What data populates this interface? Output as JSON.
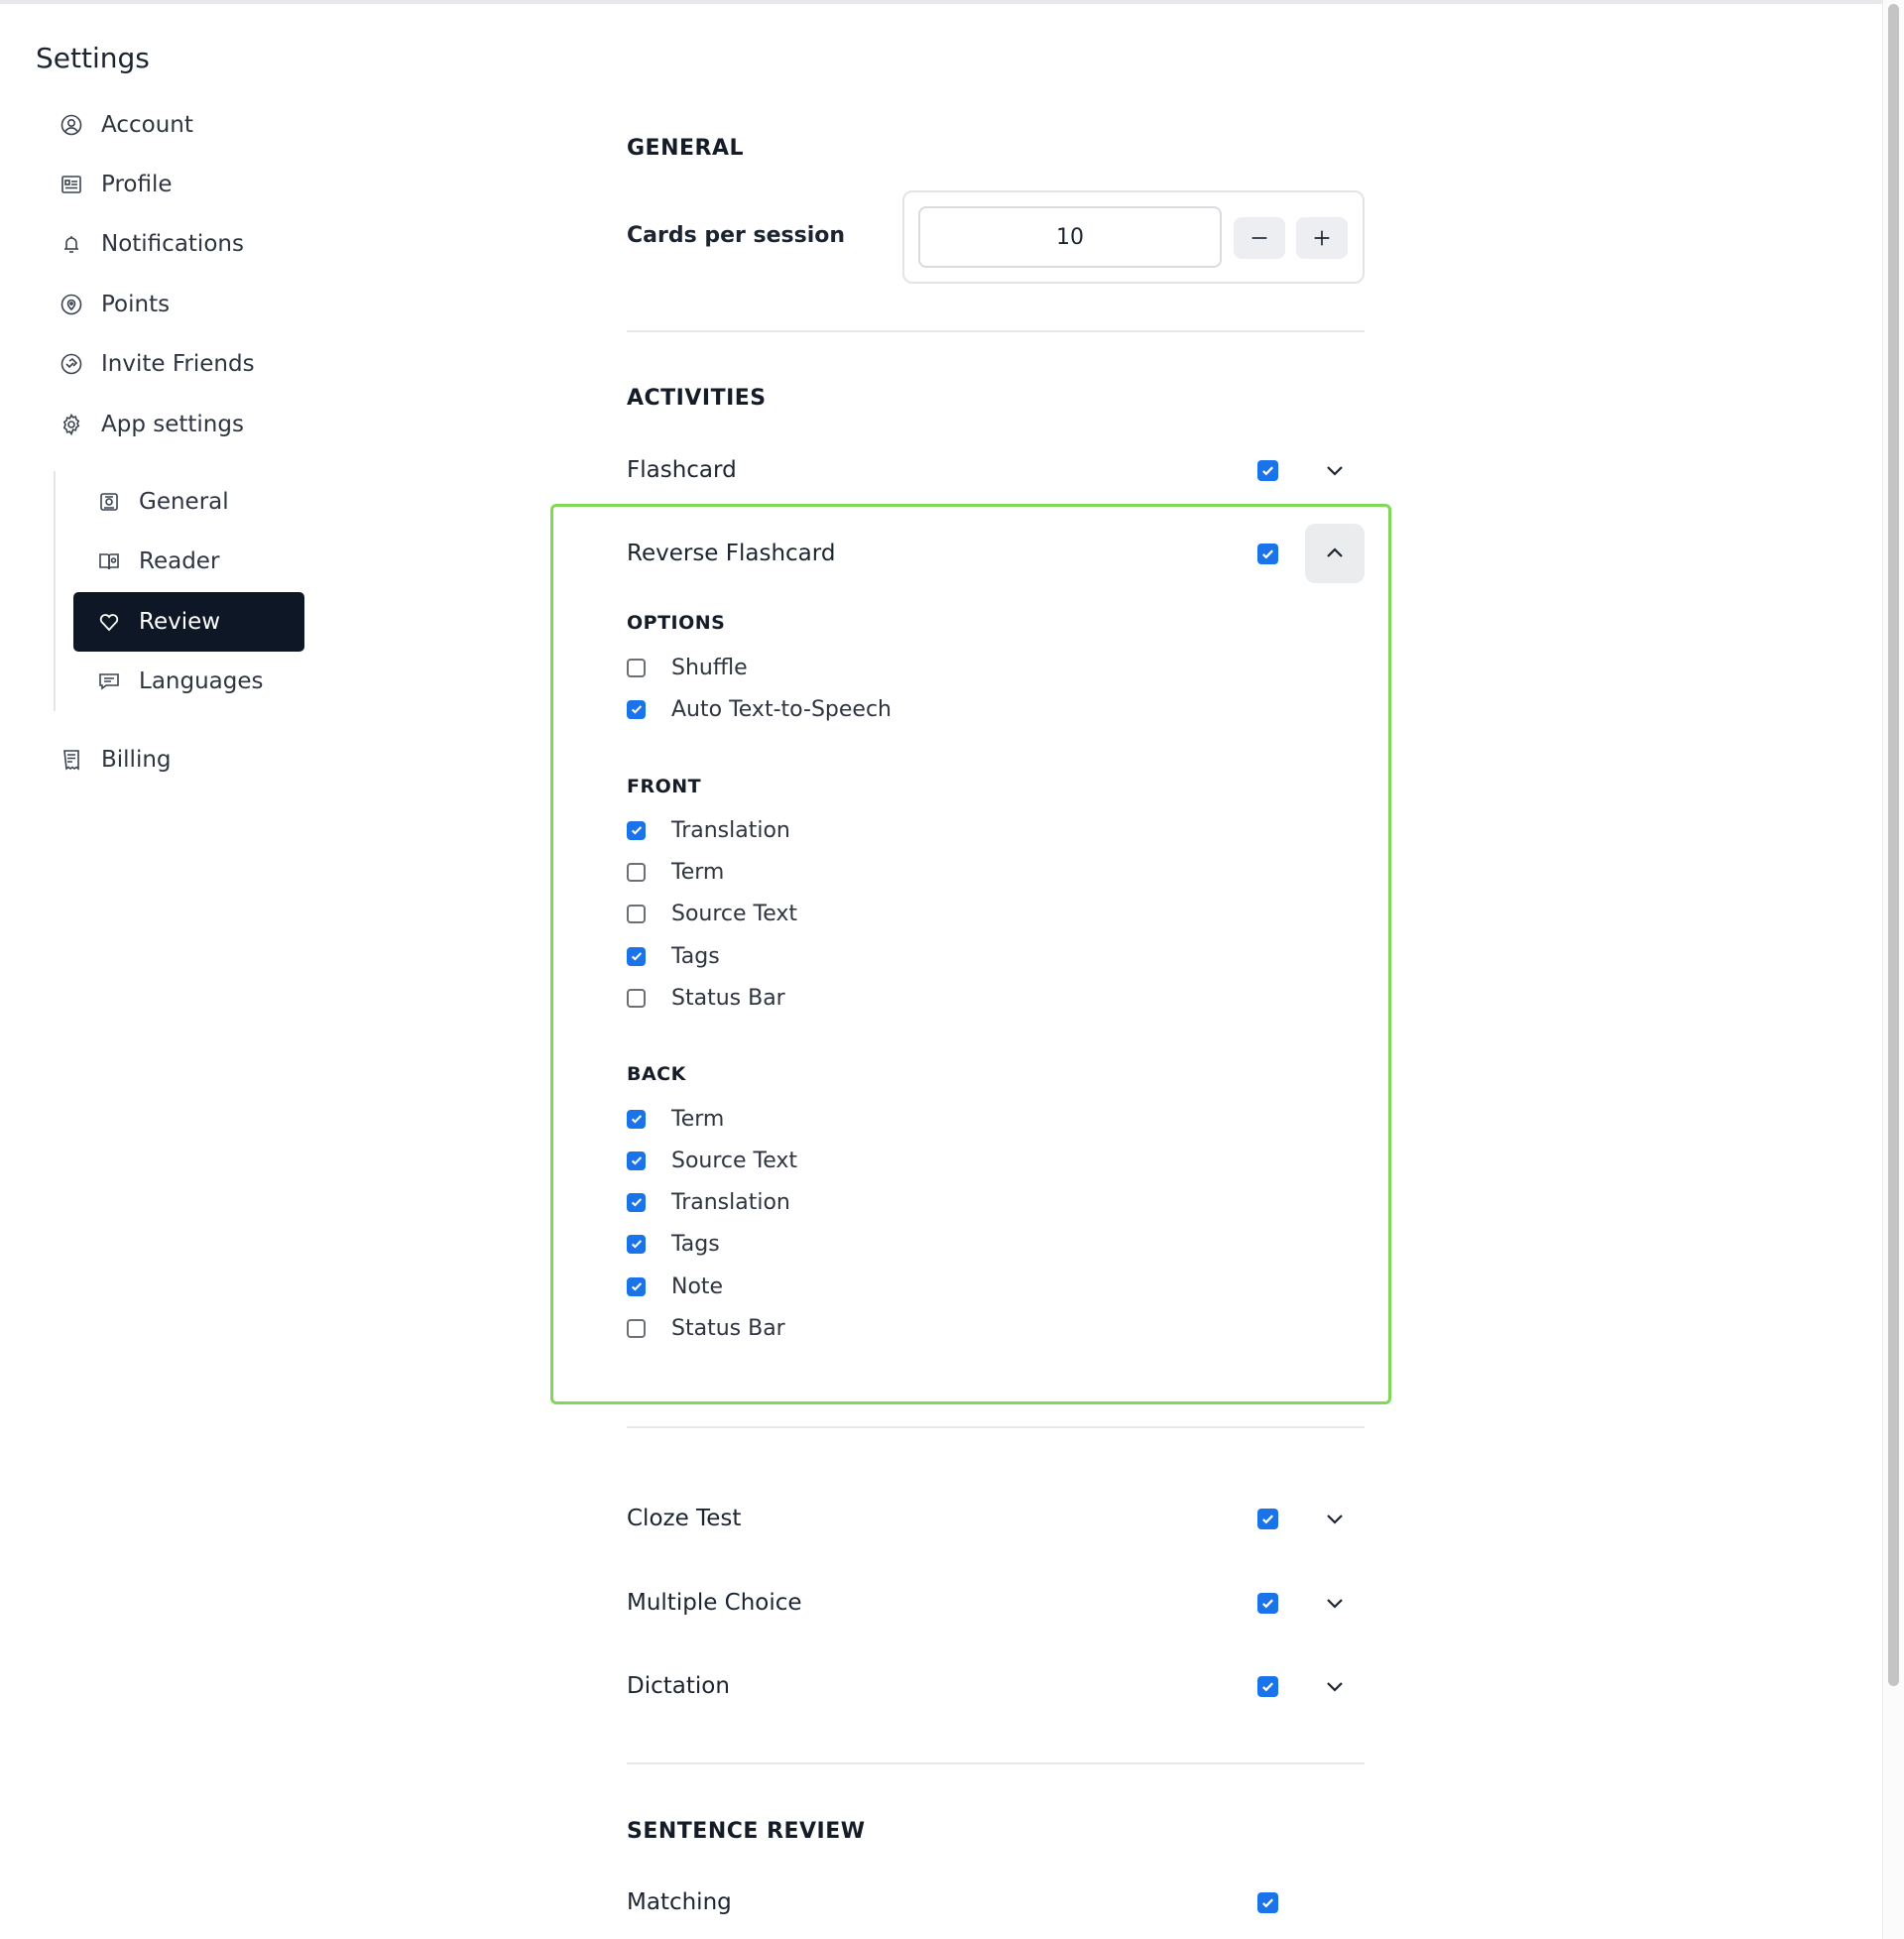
{
  "sidebar": {
    "title": "Settings",
    "items": [
      {
        "label": "Account",
        "icon": "user-circle-icon"
      },
      {
        "label": "Profile",
        "icon": "id-card-icon"
      },
      {
        "label": "Notifications",
        "icon": "bell-icon"
      },
      {
        "label": "Points",
        "icon": "location-pin-icon"
      },
      {
        "label": "Invite Friends",
        "icon": "handshake-icon"
      },
      {
        "label": "App settings",
        "icon": "gear-icon"
      }
    ],
    "sub_items": [
      {
        "label": "General",
        "icon": "settings-doc-icon"
      },
      {
        "label": "Reader",
        "icon": "book-gear-icon"
      },
      {
        "label": "Review",
        "icon": "heart-outline-icon",
        "active": true
      },
      {
        "label": "Languages",
        "icon": "chat-icon"
      }
    ],
    "billing": {
      "label": "Billing",
      "icon": "receipt-icon"
    }
  },
  "general": {
    "title": "GENERAL",
    "cards_per_session_label": "Cards per session",
    "cards_per_session_value": "10"
  },
  "activities": {
    "title": "ACTIVITIES",
    "rows": [
      {
        "label": "Flashcard",
        "checked": true
      },
      {
        "label": "Reverse Flashcard",
        "checked": true,
        "expanded": true
      },
      {
        "label": "Cloze Test",
        "checked": true
      },
      {
        "label": "Multiple Choice",
        "checked": true
      },
      {
        "label": "Dictation",
        "checked": true
      }
    ],
    "reverse_flashcard": {
      "options_title": "OPTIONS",
      "options": [
        {
          "label": "Shuffle",
          "checked": false
        },
        {
          "label": "Auto Text-to-Speech",
          "checked": true
        }
      ],
      "front_title": "FRONT",
      "front": [
        {
          "label": "Translation",
          "checked": true
        },
        {
          "label": "Term",
          "checked": false
        },
        {
          "label": "Source Text",
          "checked": false
        },
        {
          "label": "Tags",
          "checked": true
        },
        {
          "label": "Status Bar",
          "checked": false
        }
      ],
      "back_title": "BACK",
      "back": [
        {
          "label": "Term",
          "checked": true
        },
        {
          "label": "Source Text",
          "checked": true
        },
        {
          "label": "Translation",
          "checked": true
        },
        {
          "label": "Tags",
          "checked": true
        },
        {
          "label": "Note",
          "checked": true
        },
        {
          "label": "Status Bar",
          "checked": false
        }
      ]
    }
  },
  "sentence_review": {
    "title": "SENTENCE REVIEW",
    "rows": [
      {
        "label": "Matching",
        "checked": true
      }
    ]
  },
  "colors": {
    "accent": "#1a73e8",
    "active_nav_bg": "#0e1726",
    "highlight_border": "#7ed957"
  }
}
